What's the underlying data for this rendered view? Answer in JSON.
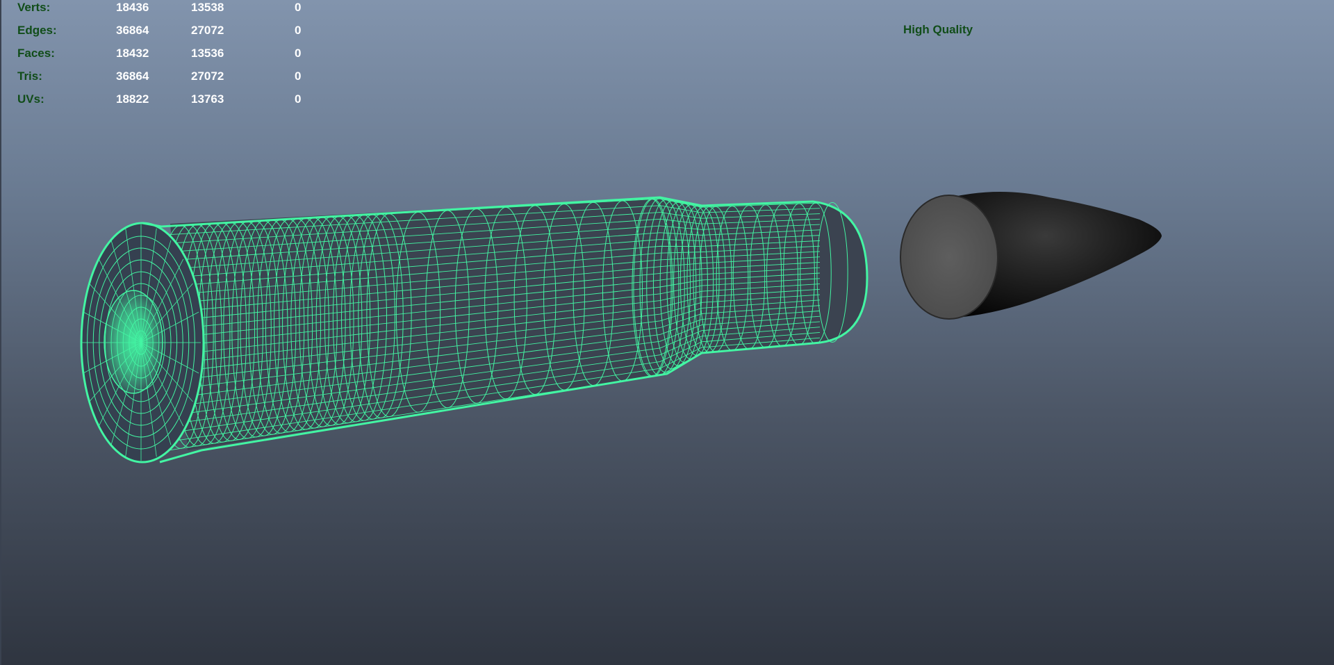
{
  "hud": {
    "rows": [
      {
        "label": "Verts:",
        "v1": "18436",
        "v2": "13538",
        "v3": "0"
      },
      {
        "label": "Edges:",
        "v1": "36864",
        "v2": "27072",
        "v3": "0"
      },
      {
        "label": "Faces:",
        "v1": "18432",
        "v2": "13536",
        "v3": "0"
      },
      {
        "label": "Tris:",
        "v1": "36864",
        "v2": "27072",
        "v3": "0"
      },
      {
        "label": "UVs:",
        "v1": "18822",
        "v2": "13763",
        "v3": "0"
      }
    ]
  },
  "viewport": {
    "quality_label": "High Quality"
  },
  "colors": {
    "hud_label": "#114d19",
    "hud_value": "#ffffff",
    "wireframe": "#43f5a3",
    "bullet": "#2b2b2b",
    "bullet_base": "#555555",
    "background_top": "#8294ad",
    "background_bottom": "#2f3540"
  },
  "icons": [
    "bullet-casing-wireframe-icon",
    "bullet-projectile-icon"
  ]
}
